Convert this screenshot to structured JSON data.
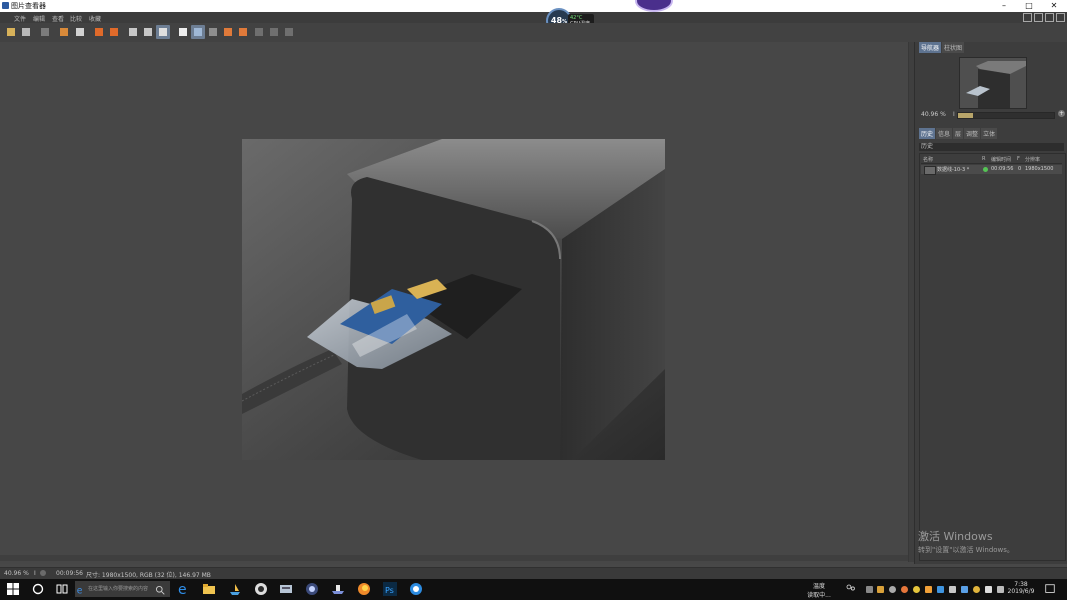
{
  "window": {
    "title": "图片查看器",
    "controls": {
      "minimize": "–",
      "maximize": "□",
      "close": "✕"
    }
  },
  "menu": [
    "文件",
    "编辑",
    "查看",
    "比较",
    "收藏"
  ],
  "cpu_widget": {
    "percent": "48",
    "percent_sign": "%",
    "temperature": "42°C",
    "label": "CPU温度"
  },
  "toolbar": {
    "buttons": [
      "open-folder-icon",
      "save-icon",
      "grid-icon",
      "fit-icon",
      "print-icon",
      "rotate-left-icon",
      "rotate-right-icon",
      "compare-icon",
      "compare-two-icon",
      "info-icon",
      "view-mode-icon",
      "grid-view-icon",
      "list-view-icon",
      "letter-a-icon",
      "letter-b-icon",
      "layout-1-icon",
      "layout-2-icon",
      "layout-3-icon"
    ]
  },
  "navigator": {
    "tabs": [
      "导航器",
      "柱状图"
    ],
    "zoom_value": "40.96 %",
    "zoom_marker": "I",
    "zoom_fraction": 0.16,
    "zoom_button": "+"
  },
  "history_panel": {
    "tabs": [
      "历史",
      "信息",
      "层",
      "调整",
      "立体"
    ],
    "section": "历史",
    "columns": {
      "name": "名称",
      "r": "R",
      "time": "编辑时间",
      "f": "F",
      "resolution": "分辨率"
    },
    "rows": [
      {
        "name": "数据线-10-3 *",
        "time": "00:09:56",
        "f": "0",
        "resolution": "1980x1500"
      }
    ]
  },
  "watermark": {
    "line1": "激活 Windows",
    "line2": "转到\"设置\"以激活 Windows。"
  },
  "status": {
    "zoom": "40.96 %",
    "marker": "I",
    "time": "00:09:56",
    "info": "尺寸: 1980x1500, RGB (32 位), 146.97 MB"
  },
  "taskbar": {
    "search_placeholder": "在这里输入你要搜索的内容",
    "tray": {
      "weather_line1": "温度",
      "weather_line2": "读取中...",
      "time": "7:38",
      "date": "2019/6/9"
    }
  },
  "colors": {
    "accent_tab": "#5e7390",
    "history_dot": "#55c455"
  }
}
